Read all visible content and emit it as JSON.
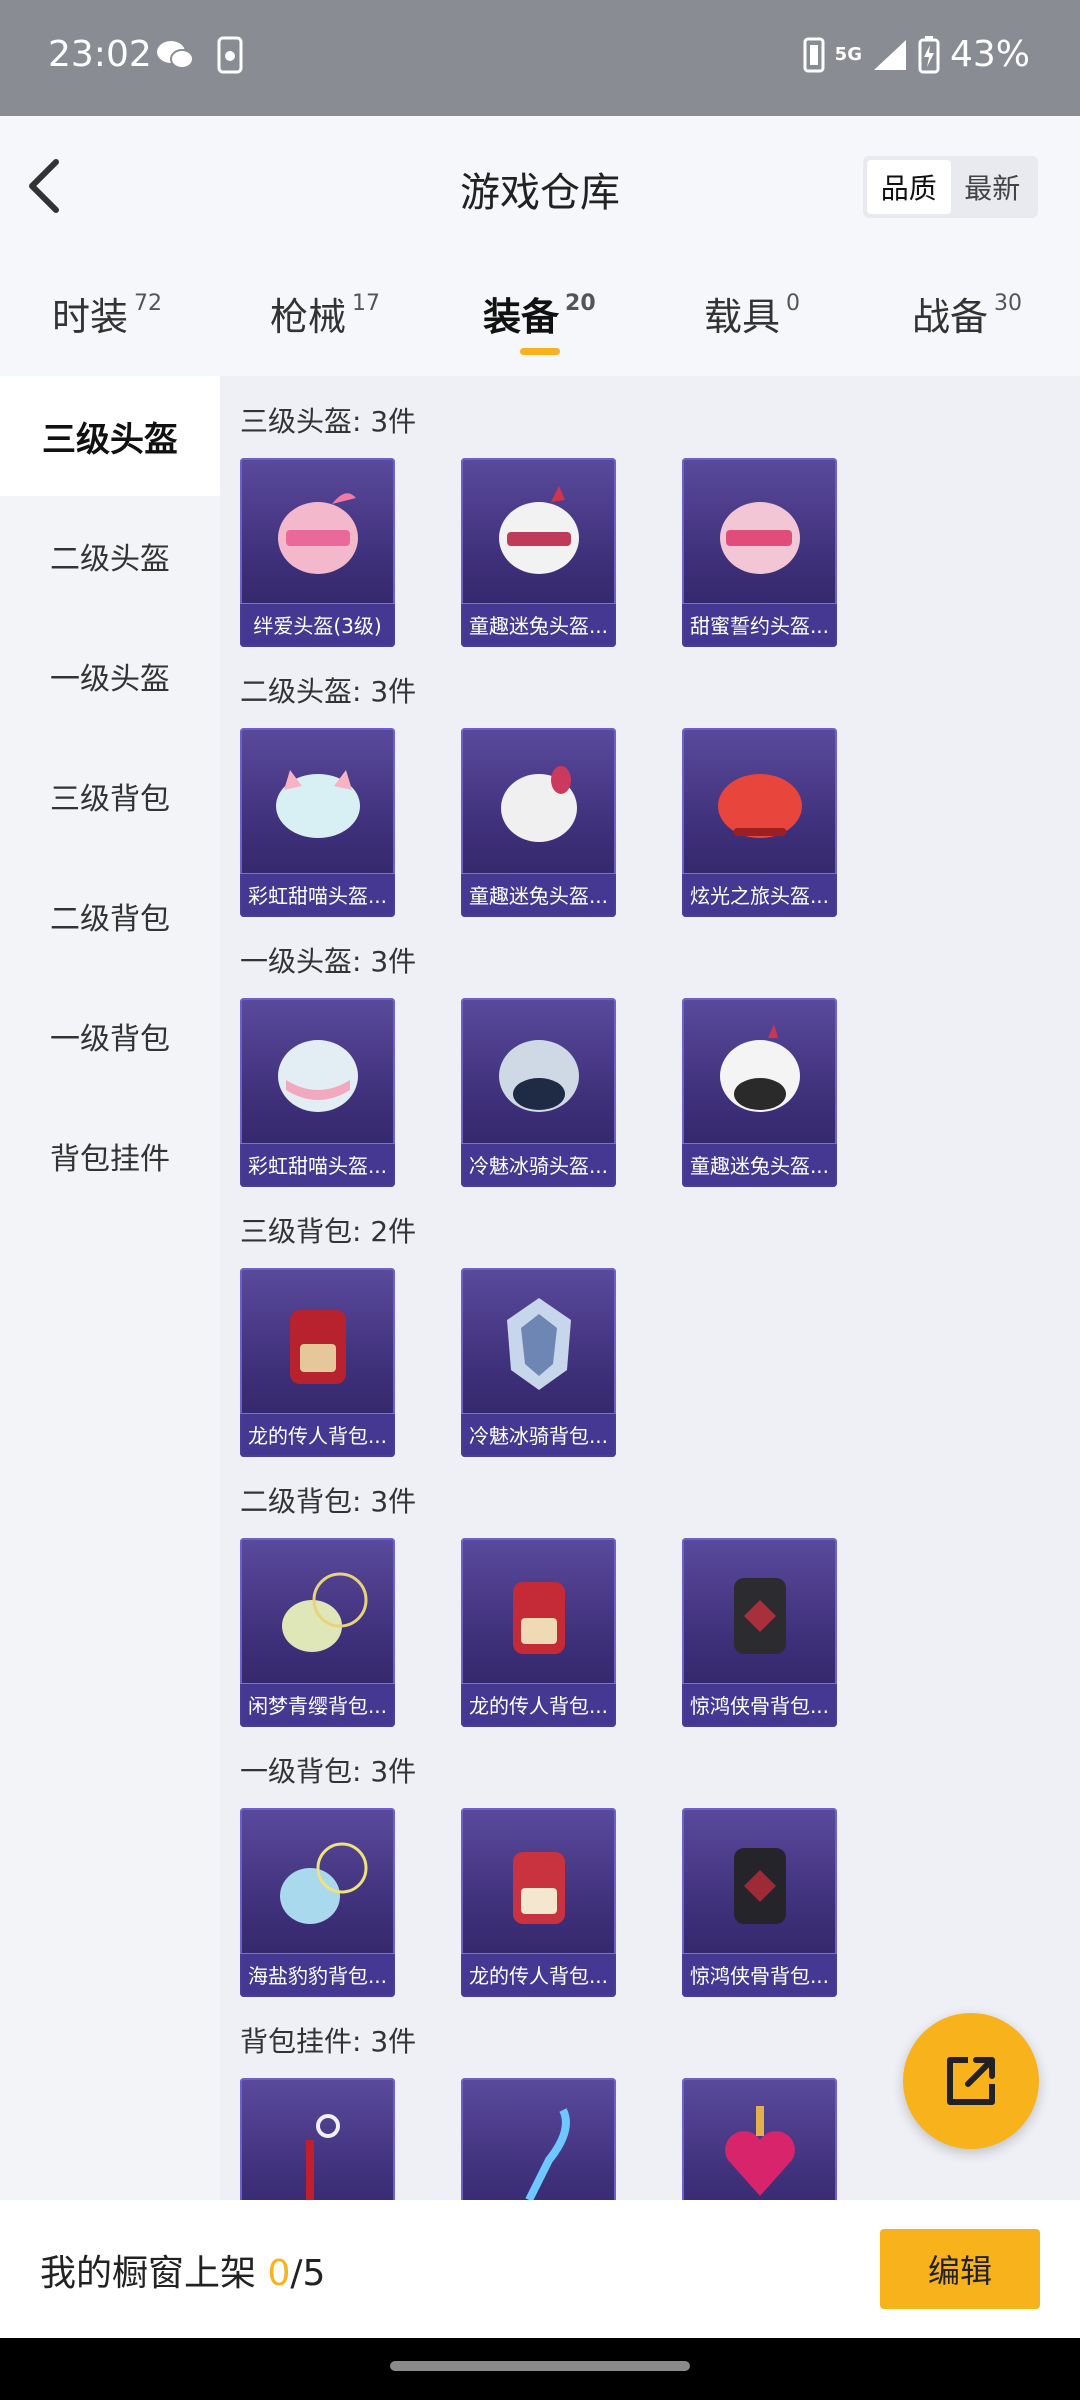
{
  "status_bar": {
    "time": "23:02",
    "network": "5G",
    "battery": "43%",
    "icons": [
      "wechat-icon",
      "phone-icon",
      "sim-icon",
      "signal-icon",
      "battery-icon"
    ]
  },
  "header": {
    "title": "游戏仓库",
    "sort_options": [
      "品质",
      "最新"
    ],
    "active_sort": "品质"
  },
  "tabs": [
    {
      "label": "时装",
      "count": "72"
    },
    {
      "label": "枪械",
      "count": "17"
    },
    {
      "label": "装备",
      "count": "20",
      "active": true
    },
    {
      "label": "载具",
      "count": "0"
    },
    {
      "label": "战备",
      "count": "30"
    }
  ],
  "side_nav": [
    "三级头盔",
    "二级头盔",
    "一级头盔",
    "三级背包",
    "二级背包",
    "一级背包",
    "背包挂件"
  ],
  "sections": [
    {
      "title": "三级头盔: 3件",
      "items": [
        "绊爱头盔(3级)",
        "童趣迷兔头盔...",
        "甜蜜誓约头盔..."
      ]
    },
    {
      "title": "二级头盔: 3件",
      "items": [
        "彩虹甜喵头盔...",
        "童趣迷兔头盔...",
        "炫光之旅头盔..."
      ]
    },
    {
      "title": "一级头盔: 3件",
      "items": [
        "彩虹甜喵头盔...",
        "冷魅冰骑头盔...",
        "童趣迷兔头盔..."
      ]
    },
    {
      "title": "三级背包: 2件",
      "items": [
        "龙的传人背包...",
        "冷魅冰骑背包..."
      ]
    },
    {
      "title": "二级背包: 3件",
      "items": [
        "闲梦青缨背包...",
        "龙的传人背包...",
        "惊鸿侠骨背包..."
      ]
    },
    {
      "title": "一级背包: 3件",
      "items": [
        "海盐豹豹背包...",
        "龙的传人背包...",
        "惊鸿侠骨背包..."
      ]
    },
    {
      "title": "背包挂件: 3件",
      "items": [
        "",
        "",
        ""
      ]
    }
  ],
  "bottom_bar": {
    "showcase_label": "我的橱窗上架",
    "showcase_count": "0",
    "showcase_total": "/5",
    "edit_label": "编辑"
  },
  "colors": {
    "accent": "#f8b21b",
    "card_top": "#5a4a9c",
    "card_bottom": "#2c2360"
  }
}
